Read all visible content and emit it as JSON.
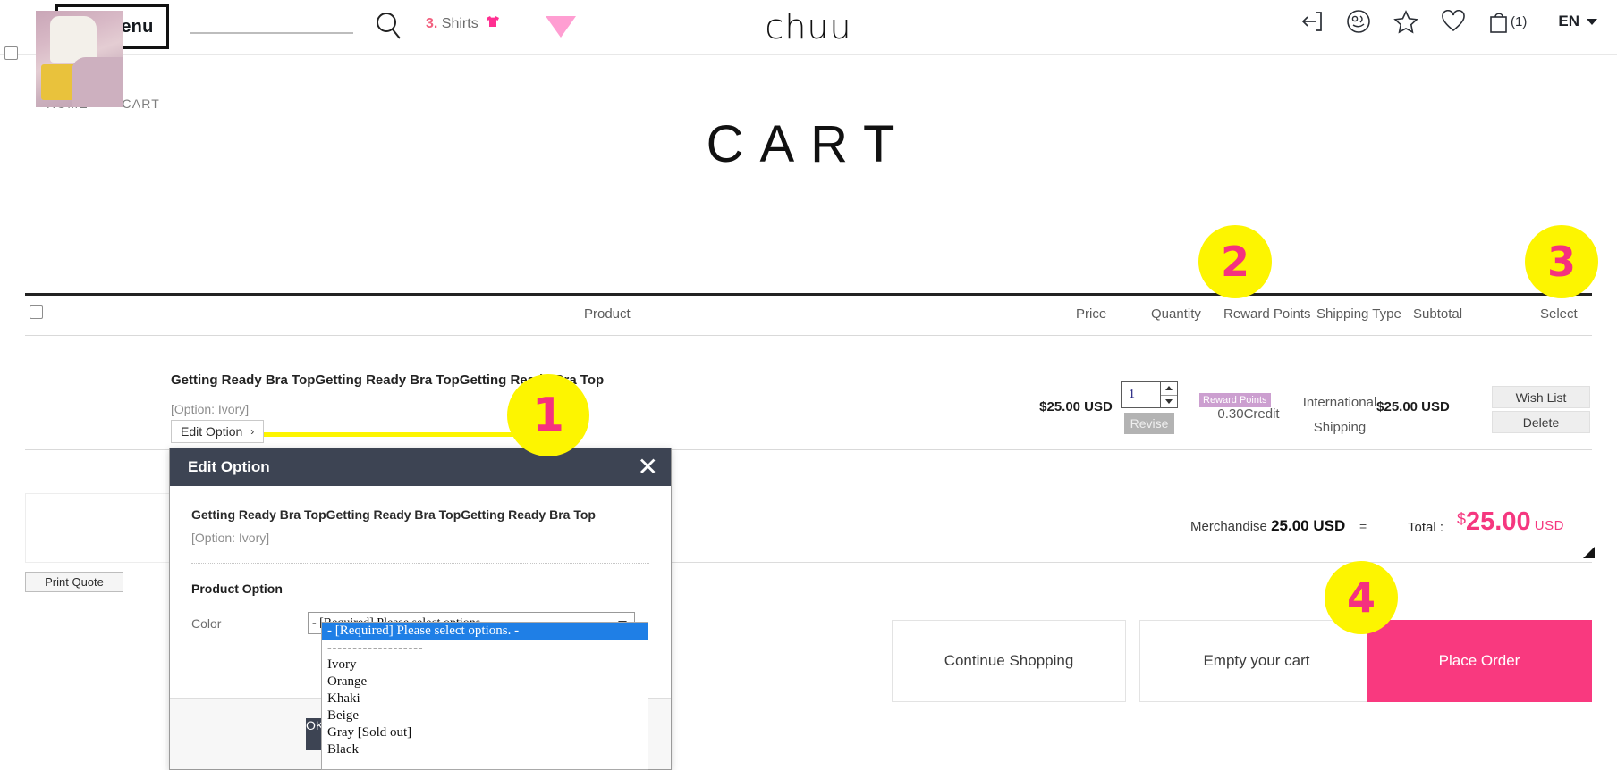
{
  "header": {
    "menu_label": "Menu",
    "search_placeholder": "",
    "search_value": "",
    "keyword_rank": "3.",
    "keyword_label": "Shirts",
    "logo": "chuu",
    "cart_count": "(1)",
    "lang": "EN",
    "icons": {
      "search": "search-icon",
      "tshirt": "tshirt-icon",
      "triangle": "pink-triangle-icon",
      "login": "login-arrow-icon",
      "face": "face-circle-icon",
      "star": "star-icon",
      "heart": "heart-icon",
      "bag": "shopping-bag-icon"
    }
  },
  "breadcrumb": {
    "home": "HOME",
    "sep": ">",
    "current": "CART"
  },
  "page_title": "CART",
  "table": {
    "headers": {
      "product": "Product",
      "price": "Price",
      "quantity": "Quantity",
      "reward_points": "Reward Points",
      "shipping_type": "Shipping Type",
      "subtotal": "Subtotal",
      "select": "Select"
    },
    "rows": [
      {
        "name": "Getting Ready Bra TopGetting Ready Bra TopGetting Ready Bra Top",
        "option": "[Option: Ivory]",
        "edit_option_label": "Edit Option",
        "edit_option_arrow": "›",
        "price": "$25.00 USD",
        "quantity": "1",
        "revise_label": "Revise",
        "reward_badge": "Reward Points",
        "reward_value": "0.30Credit",
        "shipping_line1": "International",
        "shipping_line2": "Shipping",
        "subtotal": "$25.00 USD",
        "wish_list_label": "Wish List",
        "delete_label": "Delete"
      }
    ]
  },
  "summary": {
    "merchandise_label": "Merchandise",
    "merchandise_value": "25.00 USD",
    "equals": "=",
    "total_label": "Total :",
    "total_dollar": "$",
    "total_number": "25.00",
    "total_currency": "USD",
    "print_quote_label": "Print Quote"
  },
  "actions": {
    "continue_shopping": "Continue Shopping",
    "empty_cart": "Empty your cart",
    "place_order": "Place Order"
  },
  "modal": {
    "title": "Edit Option",
    "close_icon": "✕",
    "product_name": "Getting Ready Bra TopGetting Ready Bra TopGetting Ready Bra Top",
    "product_option": "[Option: Ivory]",
    "section_title": "Product Option",
    "option_label": "Color",
    "select_value": "- [Required] Please select options. -",
    "confirm_label": "OK",
    "dropdown_options": [
      "- [Required] Please select options. -",
      "-------------------",
      "Ivory",
      "Orange",
      "Khaki",
      "Beige",
      "Gray [Sold out]",
      "Black"
    ],
    "dropdown_selected_index": 0
  },
  "annotations": [
    {
      "num": "1"
    },
    {
      "num": "2"
    },
    {
      "num": "3"
    },
    {
      "num": "4"
    }
  ],
  "colors": {
    "accent_pink": "#f9397f",
    "badge_yellow": "#fdf500",
    "modal_header": "#3d4453",
    "reward_purple": "#cc9fd0",
    "dropdown_highlight": "#1f7fe6"
  }
}
